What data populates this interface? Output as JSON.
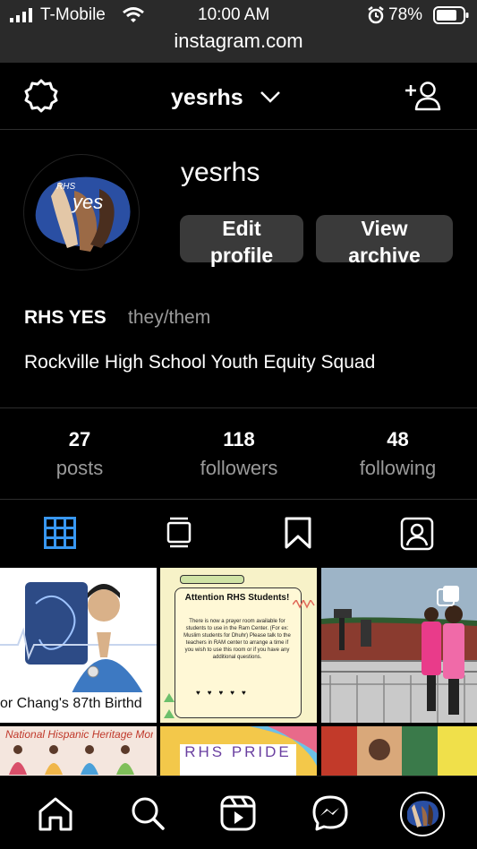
{
  "status": {
    "carrier": "T-Mobile",
    "time": "10:00 AM",
    "battery": "78%"
  },
  "browser": {
    "url": "instagram.com"
  },
  "header": {
    "username": "yesrhs"
  },
  "profile": {
    "username": "yesrhs",
    "avatar_text": "RHS",
    "avatar_word": "yes",
    "edit_label_1": "Edit",
    "edit_label_2": "profile",
    "archive_label_1": "View",
    "archive_label_2": "archive",
    "name": "RHS YES",
    "pronouns": "they/them",
    "bio": "Rockville High School Youth Equity Squad"
  },
  "stats": {
    "posts_count": "27",
    "posts_label": "posts",
    "followers_count": "118",
    "followers_label": "followers",
    "following_count": "48",
    "following_label": "following"
  },
  "tabs": {
    "active": "grid",
    "accent": "#3897f0"
  },
  "posts": {
    "p1_caption": "or Chang's 87th Birthd",
    "p2_title": "Attention RHS Students!",
    "p2_body": "There is now a prayer room available for students to use in the Ram Center. (For ex: Muslim students for Dhuhr) Please talk to the teachers in RAM center to arrange a time if you wish to use this room or if you have any additional questions.",
    "p4_caption": "National Hispanic Heritage Month",
    "p5_caption": "RHS PRIDE"
  },
  "colors": {
    "bg": "#000000",
    "bar": "#2a2a2a",
    "button": "#3a3a3a",
    "muted": "#9a9a9a",
    "accent": "#3897f0"
  }
}
